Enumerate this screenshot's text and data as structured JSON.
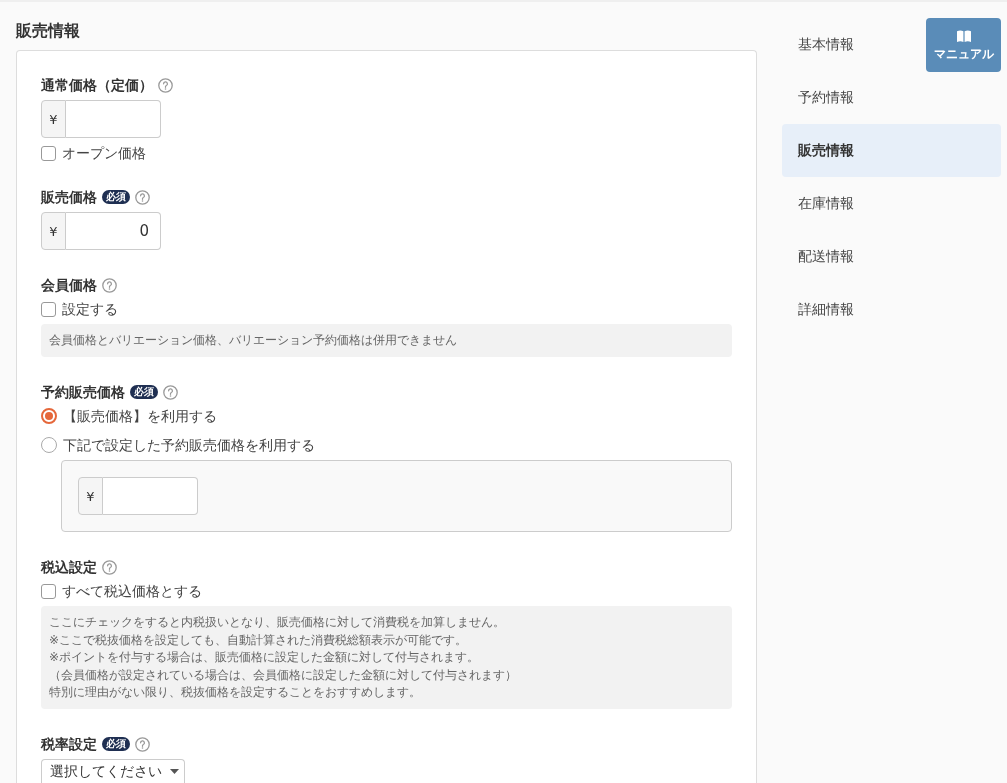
{
  "page_title": "販売情報",
  "form": {
    "sections": [
      {
        "label": "通常価格（定価）",
        "items": [
          {
            "kind": "price_input",
            "prefix": "¥"
          },
          {
            "kind": "checkbox",
            "label": "オープン価格",
            "checked": false
          }
        ]
      },
      {
        "label": "販売価格",
        "badge": "必須",
        "items": [
          {
            "kind": "price_input",
            "prefix": "¥",
            "value": "0"
          }
        ]
      },
      {
        "label": "会員価格",
        "items": [
          {
            "kind": "checkbox",
            "label": "設定する",
            "checked": false
          },
          {
            "kind": "note",
            "lines": [
              "会員価格とバリエーション価格、バリエーション予約価格は併用できません"
            ]
          }
        ]
      },
      {
        "label": "予約販売価格",
        "badge": "必須",
        "items": [
          {
            "kind": "radio",
            "label": "【販売価格】を利用する",
            "selected": true
          },
          {
            "kind": "radio",
            "label": "下記で設定した予約販売価格を利用する",
            "selected": false
          },
          {
            "kind": "nested_price_input",
            "prefix": "¥"
          }
        ]
      },
      {
        "label": "税込設定",
        "items": [
          {
            "kind": "checkbox",
            "label": "すべて税込価格とする",
            "checked": false
          },
          {
            "kind": "note",
            "lines": [
              "ここにチェックをすると内税扱いとなり、販売価格に対して消費税を加算しません。",
              "※ここで税抜価格を設定しても、自動計算された消費税総額表示が可能です。",
              "※ポイントを付与する場合は、販売価格に設定した金額に対して付与されます。",
              "（会員価格が設定されている場合は、会員価格に設定した金額に対して付与されます）",
              "特別に理由がない限り、税抜価格を設定することをおすすめします。"
            ]
          }
        ]
      },
      {
        "label": "税率設定",
        "badge": "必須",
        "items": [
          {
            "kind": "select",
            "value": "選択してください"
          }
        ]
      }
    ]
  },
  "side_nav": {
    "items": [
      {
        "label": "基本情報",
        "selected": false
      },
      {
        "label": "予約情報",
        "selected": false
      },
      {
        "label": "販売情報",
        "selected": true
      },
      {
        "label": "在庫情報",
        "selected": false
      },
      {
        "label": "配送情報",
        "selected": false
      },
      {
        "label": "詳細情報",
        "selected": false
      }
    ]
  },
  "manual_button": {
    "label": "マニュアル"
  }
}
